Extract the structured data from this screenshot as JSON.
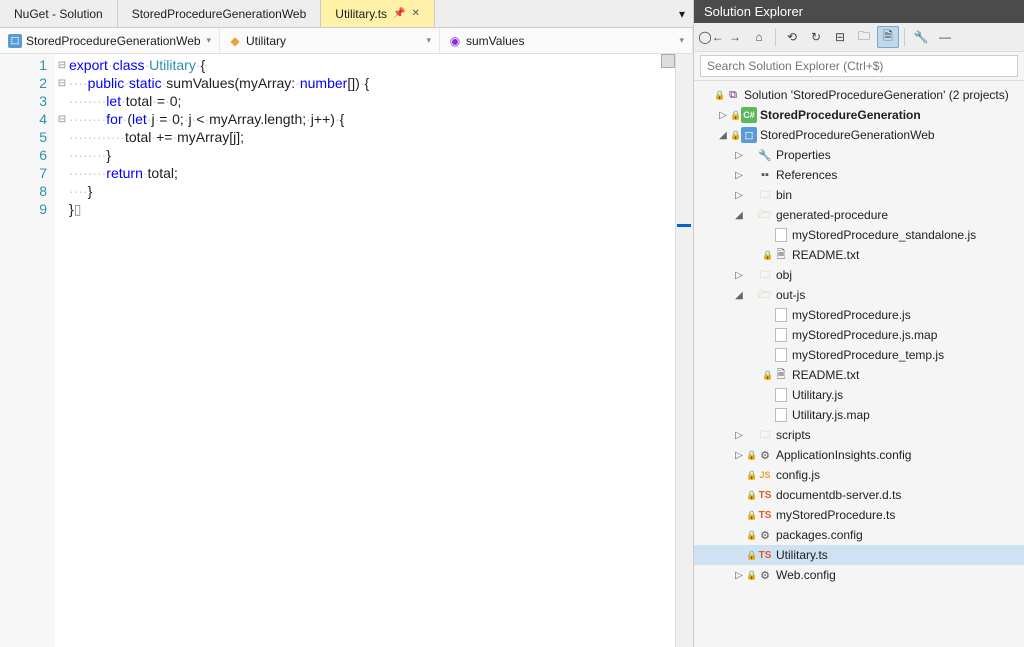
{
  "tabs": [
    {
      "label": "NuGet - Solution"
    },
    {
      "label": "StoredProcedureGenerationWeb"
    },
    {
      "label": "Utilitary.ts",
      "active": true
    }
  ],
  "nav": {
    "scope": "StoredProcedureGenerationWeb",
    "class": "Utilitary",
    "member": "sumValues"
  },
  "code": {
    "lines": [
      {
        "n": "1",
        "fold": "⊟",
        "ind": 0,
        "tokens": [
          [
            "kw",
            "export"
          ],
          [
            "p",
            " "
          ],
          [
            "kw",
            "class"
          ],
          [
            "p",
            " "
          ],
          [
            "typ",
            "Utilitary"
          ],
          [
            "p",
            " {"
          ]
        ]
      },
      {
        "n": "2",
        "fold": "⊟",
        "ind": 4,
        "tokens": [
          [
            "kw",
            "public"
          ],
          [
            "p",
            " "
          ],
          [
            "kw",
            "static"
          ],
          [
            "p",
            " sumValues(myArray: "
          ],
          [
            "kw",
            "number"
          ],
          [
            "p",
            "[]) {"
          ]
        ]
      },
      {
        "n": "3",
        "fold": "",
        "ind": 8,
        "tokens": [
          [
            "kw",
            "let"
          ],
          [
            "p",
            " total = 0;"
          ]
        ]
      },
      {
        "n": "4",
        "fold": "⊟",
        "ind": 8,
        "tokens": [
          [
            "kw",
            "for"
          ],
          [
            "p",
            " ("
          ],
          [
            "kw",
            "let"
          ],
          [
            "p",
            " j = 0; j < myArray.length; j++) {"
          ]
        ]
      },
      {
        "n": "5",
        "fold": "",
        "ind": 12,
        "tokens": [
          [
            "p",
            "total += myArray[j];"
          ]
        ]
      },
      {
        "n": "6",
        "fold": "",
        "ind": 8,
        "tokens": [
          [
            "p",
            "}"
          ]
        ]
      },
      {
        "n": "7",
        "fold": "",
        "ind": 8,
        "tokens": [
          [
            "kw",
            "return"
          ],
          [
            "p",
            " total;"
          ]
        ]
      },
      {
        "n": "8",
        "fold": "",
        "ind": 4,
        "tokens": [
          [
            "p",
            "}"
          ]
        ]
      },
      {
        "n": "9",
        "fold": "",
        "ind": 0,
        "tokens": [
          [
            "p",
            "}"
          ],
          [
            "cursor-end",
            "▯"
          ]
        ]
      }
    ]
  },
  "explorer": {
    "title": "Solution Explorer",
    "searchPlaceholder": "Search Solution Explorer (Ctrl+$)",
    "solution": "Solution 'StoredProcedureGeneration' (2 projects)",
    "tree": [
      {
        "d": 0,
        "exp": "",
        "lock": "🔒",
        "icon": "sln",
        "label": "__SOL__"
      },
      {
        "d": 1,
        "exp": "▷",
        "lock": "🔒",
        "icon": "csproj",
        "label": "StoredProcedureGeneration",
        "bold": true
      },
      {
        "d": 1,
        "exp": "◢",
        "lock": "🔒",
        "icon": "tsproj",
        "label": "StoredProcedureGenerationWeb"
      },
      {
        "d": 2,
        "exp": "▷",
        "lock": "",
        "icon": "wrench",
        "label": "Properties"
      },
      {
        "d": 2,
        "exp": "▷",
        "lock": "",
        "icon": "ref",
        "label": "References"
      },
      {
        "d": 2,
        "exp": "▷",
        "lock": "",
        "icon": "folder",
        "label": "bin"
      },
      {
        "d": 2,
        "exp": "◢",
        "lock": "",
        "icon": "folder-open",
        "label": "generated-procedure"
      },
      {
        "d": 3,
        "exp": "",
        "lock": "",
        "icon": "file",
        "label": "myStoredProcedure_standalone.js"
      },
      {
        "d": 3,
        "exp": "",
        "lock": "🔒",
        "icon": "txt",
        "label": "README.txt"
      },
      {
        "d": 2,
        "exp": "▷",
        "lock": "",
        "icon": "folder",
        "label": "obj"
      },
      {
        "d": 2,
        "exp": "◢",
        "lock": "",
        "icon": "folder-open",
        "label": "out-js"
      },
      {
        "d": 3,
        "exp": "",
        "lock": "",
        "icon": "file",
        "label": "myStoredProcedure.js"
      },
      {
        "d": 3,
        "exp": "",
        "lock": "",
        "icon": "file",
        "label": "myStoredProcedure.js.map"
      },
      {
        "d": 3,
        "exp": "",
        "lock": "",
        "icon": "file",
        "label": "myStoredProcedure_temp.js"
      },
      {
        "d": 3,
        "exp": "",
        "lock": "🔒",
        "icon": "txt",
        "label": "README.txt"
      },
      {
        "d": 3,
        "exp": "",
        "lock": "",
        "icon": "file",
        "label": "Utilitary.js"
      },
      {
        "d": 3,
        "exp": "",
        "lock": "",
        "icon": "file",
        "label": "Utilitary.js.map"
      },
      {
        "d": 2,
        "exp": "▷",
        "lock": "",
        "icon": "folder",
        "label": "scripts"
      },
      {
        "d": 2,
        "exp": "▷",
        "lock": "🔒",
        "icon": "config",
        "label": "ApplicationInsights.config"
      },
      {
        "d": 2,
        "exp": "",
        "lock": "🔒",
        "icon": "js",
        "label": "config.js"
      },
      {
        "d": 2,
        "exp": "",
        "lock": "🔒",
        "icon": "ts",
        "label": "documentdb-server.d.ts"
      },
      {
        "d": 2,
        "exp": "",
        "lock": "🔒",
        "icon": "ts",
        "label": "myStoredProcedure.ts"
      },
      {
        "d": 2,
        "exp": "",
        "lock": "🔒",
        "icon": "config",
        "label": "packages.config"
      },
      {
        "d": 2,
        "exp": "",
        "lock": "🔒",
        "icon": "ts",
        "label": "Utilitary.ts",
        "selected": true
      },
      {
        "d": 2,
        "exp": "▷",
        "lock": "🔒",
        "icon": "config",
        "label": "Web.config"
      }
    ]
  }
}
